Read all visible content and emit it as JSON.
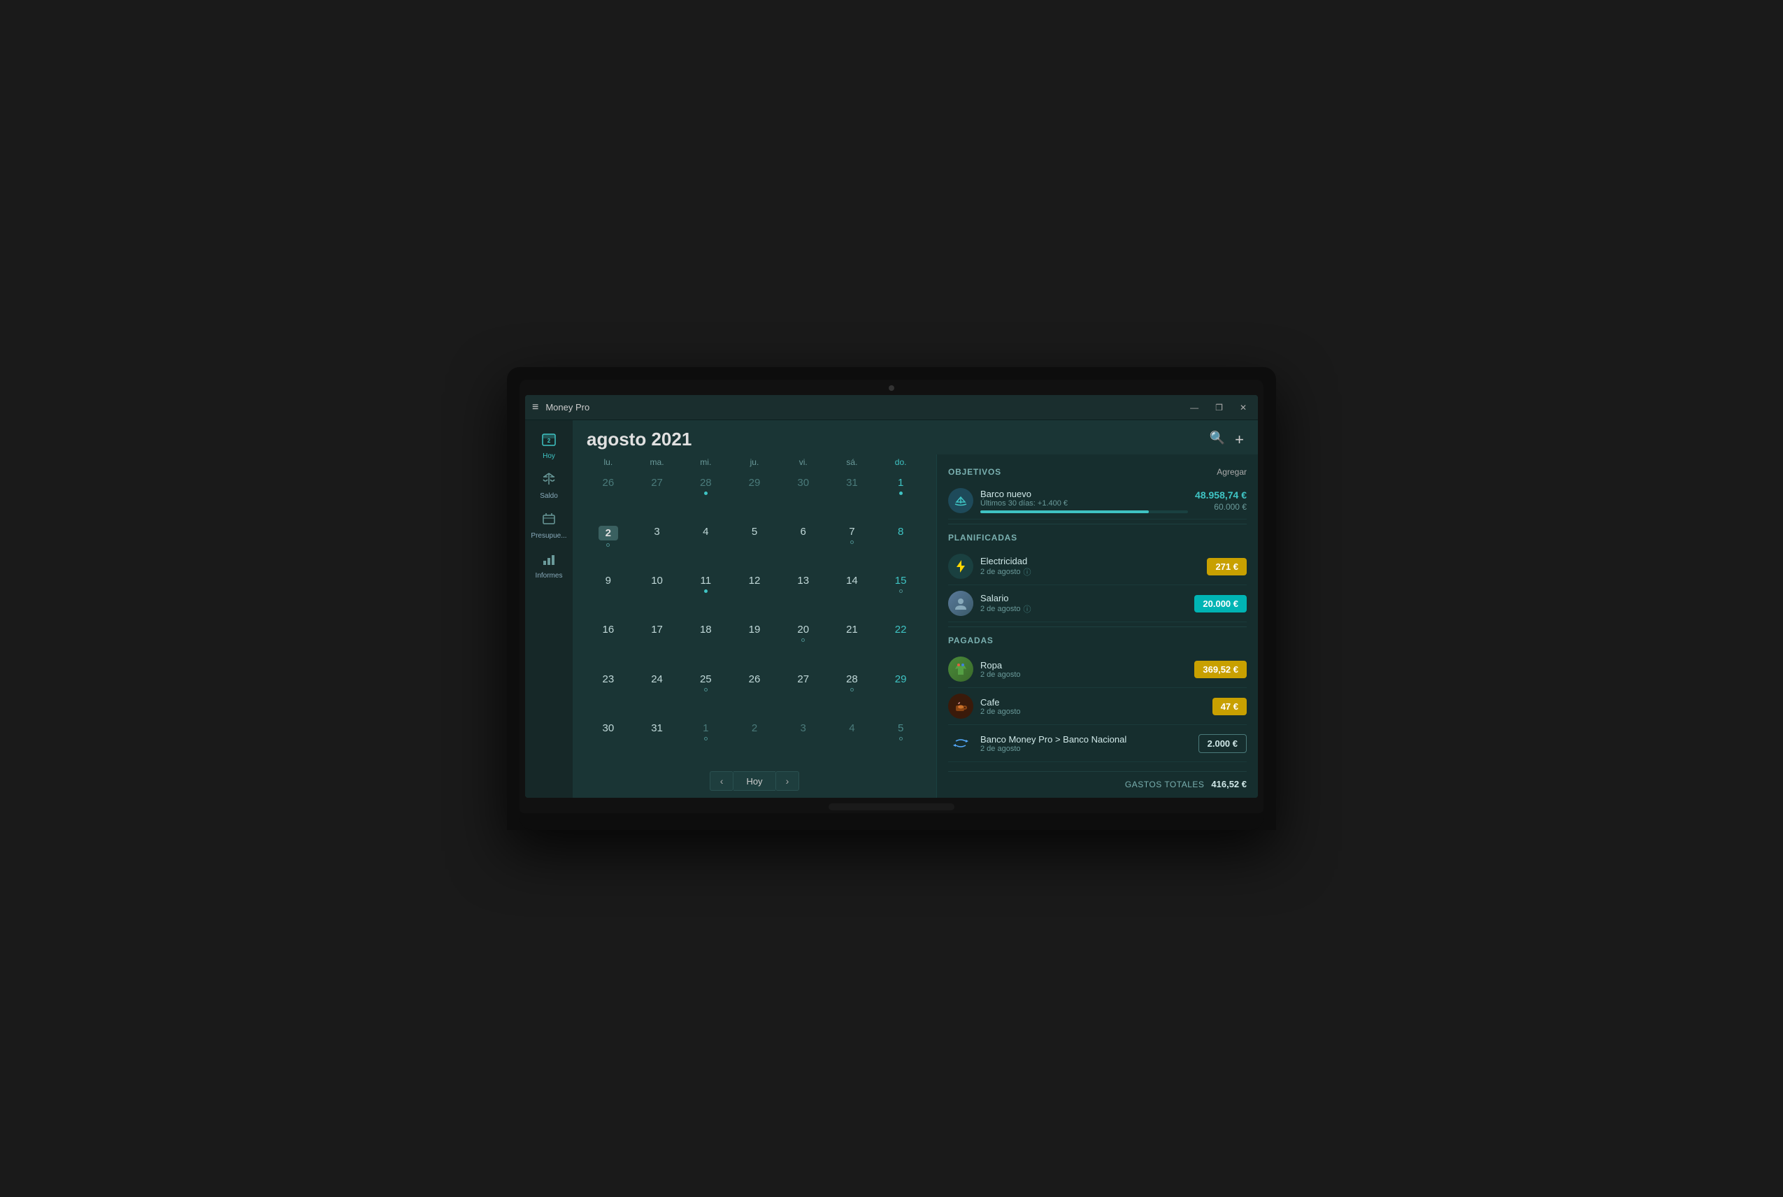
{
  "window": {
    "title": "Money Pro",
    "minimize_label": "—",
    "maximize_label": "❐",
    "close_label": "✕"
  },
  "sidebar": {
    "hamburger": "≡",
    "items": [
      {
        "id": "hoy",
        "icon": "📅",
        "label": "Hoy",
        "active": true
      },
      {
        "id": "saldo",
        "icon": "⚖",
        "label": "Saldo"
      },
      {
        "id": "presupuesto",
        "icon": "⚖",
        "label": "Presupue..."
      },
      {
        "id": "informes",
        "icon": "📊",
        "label": "Informes"
      }
    ]
  },
  "calendar": {
    "month": "agosto",
    "year": "2021",
    "search_icon": "🔍",
    "add_icon": "+",
    "days_of_week": [
      "lu.",
      "ma.",
      "mi.",
      "ju.",
      "vi.",
      "sá.",
      "do."
    ],
    "weeks": [
      [
        {
          "day": "26",
          "other": true,
          "dot": false,
          "empty_dot": false
        },
        {
          "day": "27",
          "other": true,
          "dot": false,
          "empty_dot": false
        },
        {
          "day": "28",
          "other": true,
          "dot": true,
          "empty_dot": false
        },
        {
          "day": "29",
          "other": true,
          "dot": false,
          "empty_dot": false
        },
        {
          "day": "30",
          "other": true,
          "dot": false,
          "empty_dot": false
        },
        {
          "day": "31",
          "other": true,
          "dot": false,
          "empty_dot": false
        },
        {
          "day": "1",
          "other": false,
          "dot": true,
          "empty_dot": false,
          "sunday": true
        }
      ],
      [
        {
          "day": "2",
          "other": false,
          "today": true,
          "dot": false,
          "empty_dot": true
        },
        {
          "day": "3",
          "other": false,
          "dot": false,
          "empty_dot": false
        },
        {
          "day": "4",
          "other": false,
          "dot": false,
          "empty_dot": false
        },
        {
          "day": "5",
          "other": false,
          "dot": false,
          "empty_dot": false
        },
        {
          "day": "6",
          "other": false,
          "dot": false,
          "empty_dot": false
        },
        {
          "day": "7",
          "other": false,
          "dot": false,
          "empty_dot": true
        },
        {
          "day": "8",
          "other": false,
          "dot": false,
          "empty_dot": false,
          "sunday": true
        }
      ],
      [
        {
          "day": "9",
          "other": false,
          "dot": false,
          "empty_dot": false
        },
        {
          "day": "10",
          "other": false,
          "dot": false,
          "empty_dot": false
        },
        {
          "day": "11",
          "other": false,
          "dot": true,
          "empty_dot": false
        },
        {
          "day": "12",
          "other": false,
          "dot": false,
          "empty_dot": false
        },
        {
          "day": "13",
          "other": false,
          "dot": false,
          "empty_dot": false
        },
        {
          "day": "14",
          "other": false,
          "dot": false,
          "empty_dot": false
        },
        {
          "day": "15",
          "other": false,
          "dot": false,
          "empty_dot": true,
          "sunday": true
        }
      ],
      [
        {
          "day": "16",
          "other": false,
          "dot": false,
          "empty_dot": false
        },
        {
          "day": "17",
          "other": false,
          "dot": false,
          "empty_dot": false
        },
        {
          "day": "18",
          "other": false,
          "dot": false,
          "empty_dot": false
        },
        {
          "day": "19",
          "other": false,
          "dot": false,
          "empty_dot": false
        },
        {
          "day": "20",
          "other": false,
          "dot": false,
          "empty_dot": true
        },
        {
          "day": "21",
          "other": false,
          "dot": false,
          "empty_dot": false
        },
        {
          "day": "22",
          "other": false,
          "dot": false,
          "empty_dot": false,
          "sunday": true
        }
      ],
      [
        {
          "day": "23",
          "other": false,
          "dot": false,
          "empty_dot": false
        },
        {
          "day": "24",
          "other": false,
          "dot": false,
          "empty_dot": false
        },
        {
          "day": "25",
          "other": false,
          "dot": false,
          "empty_dot": true
        },
        {
          "day": "26",
          "other": false,
          "dot": false,
          "empty_dot": false
        },
        {
          "day": "27",
          "other": false,
          "dot": false,
          "empty_dot": false
        },
        {
          "day": "28",
          "other": false,
          "dot": false,
          "empty_dot": true
        },
        {
          "day": "29",
          "other": false,
          "dot": false,
          "empty_dot": false,
          "sunday": true
        }
      ],
      [
        {
          "day": "30",
          "other": false,
          "dot": false,
          "empty_dot": false
        },
        {
          "day": "31",
          "other": false,
          "dot": false,
          "empty_dot": false
        },
        {
          "day": "1",
          "other": true,
          "dot": false,
          "empty_dot": true
        },
        {
          "day": "2",
          "other": true,
          "dot": false,
          "empty_dot": false
        },
        {
          "day": "3",
          "other": true,
          "dot": false,
          "empty_dot": false
        },
        {
          "day": "4",
          "other": true,
          "dot": false,
          "empty_dot": false
        },
        {
          "day": "5",
          "other": true,
          "dot": false,
          "empty_dot": true,
          "sunday": true
        }
      ]
    ],
    "nav": {
      "prev": "‹",
      "today": "Hoy",
      "next": "›"
    }
  },
  "right_panel": {
    "objetivos": {
      "section_title": "OBJETIVOS",
      "action_label": "Agregar",
      "items": [
        {
          "icon": "⛵",
          "name": "Barco nuevo",
          "sub": "Últimos 30 días: +1.400 €",
          "amount_primary": "48.958,74 €",
          "amount_secondary": "60.000 €",
          "progress_pct": 81
        }
      ]
    },
    "planificadas": {
      "section_title": "PLANIFICADAS",
      "items": [
        {
          "icon": "⚡",
          "name": "Electricidad",
          "sub": "2 de agosto",
          "amount": "271 €",
          "type": "expense"
        },
        {
          "icon": "👤",
          "name": "Salario",
          "sub": "2 de agosto",
          "amount": "20.000 €",
          "type": "income"
        }
      ]
    },
    "pagadas": {
      "section_title": "PAGADAS",
      "items": [
        {
          "icon": "🎨",
          "name": "Ropa",
          "sub": "2 de agosto",
          "amount": "369,52 €",
          "type": "expense"
        },
        {
          "icon": "☕",
          "name": "Cafe",
          "sub": "2 de agosto",
          "amount": "47 €",
          "type": "expense"
        },
        {
          "icon": "🔄",
          "name": "Banco Money Pro > Banco Nacional",
          "sub": "2 de agosto",
          "amount": "2.000 €",
          "type": "transfer"
        }
      ]
    },
    "total": {
      "label": "GASTOS TOTALES",
      "amount": "416,52 €"
    }
  }
}
